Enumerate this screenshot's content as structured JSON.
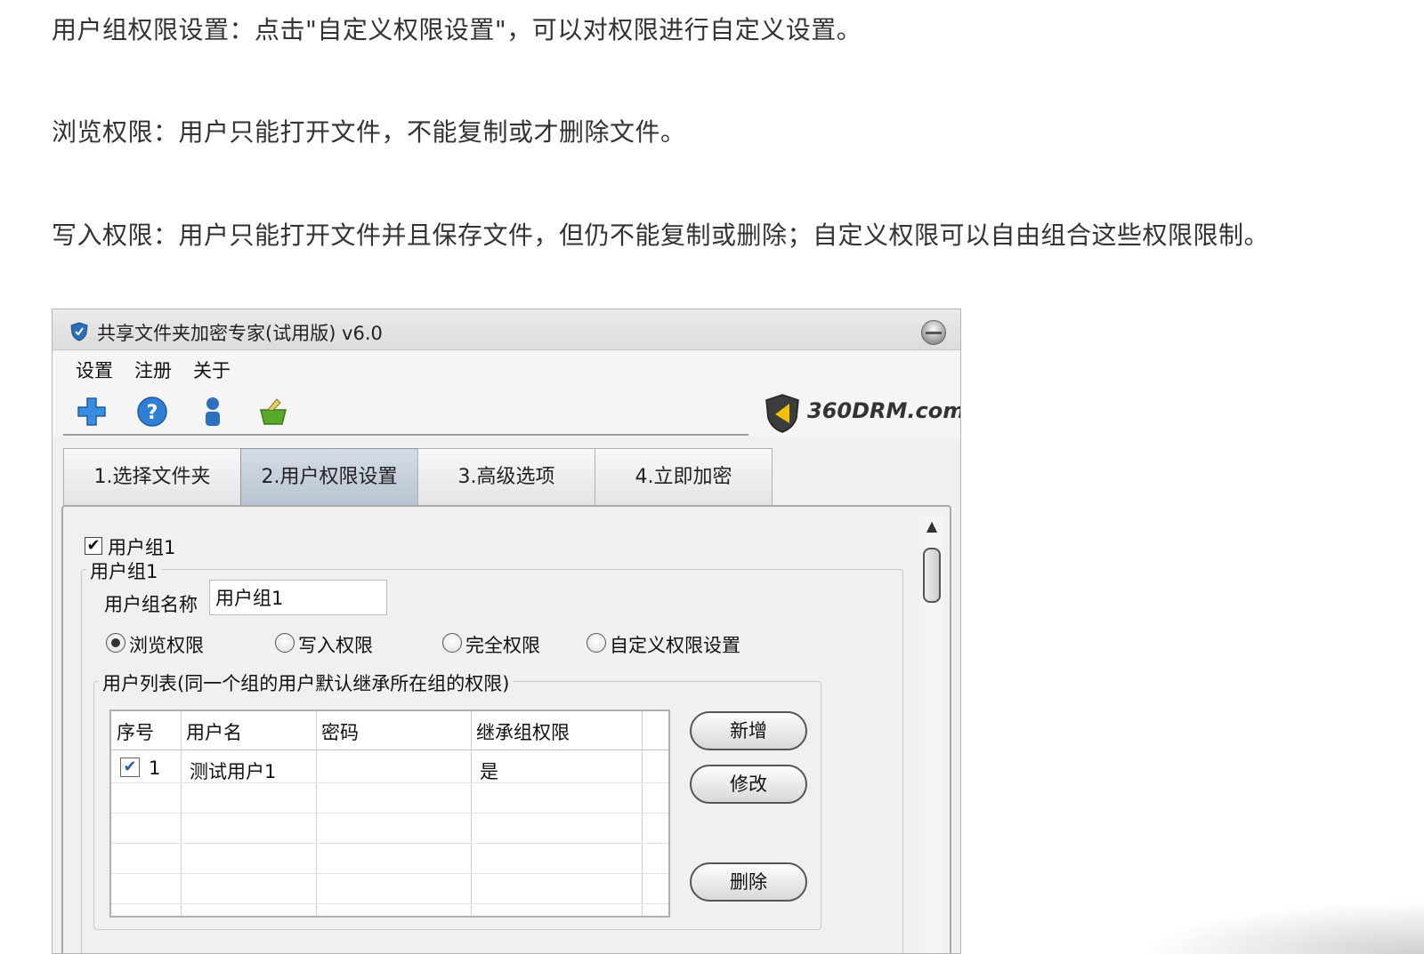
{
  "article": {
    "p1": "用户组权限设置：点击\"自定义权限设置\"，可以对权限进行自定义设置。",
    "p2": "浏览权限：用户只能打开文件，不能复制或才删除文件。",
    "p3": "写入权限：用户只能打开文件并且保存文件，但仍不能复制或删除；自定义权限可以自由组合这些权限限制。"
  },
  "window": {
    "title": "共享文件夹加密专家(试用版) v6.0",
    "menu": [
      "设置",
      "注册",
      "关于"
    ],
    "toolbar_icons": [
      "plus-icon",
      "help-icon",
      "user-icon",
      "basket-icon"
    ],
    "logo_text": "360DRM.com",
    "tabs": [
      "1.选择文件夹",
      "2.用户权限设置",
      "3.高级选项",
      "4.立即加密"
    ],
    "active_tab": 1
  },
  "group": {
    "checkbox_label": "用户组1",
    "checked": true,
    "box_title": "用户组1",
    "name_label": "用户组名称",
    "name_value": "用户组1",
    "permissions": [
      "浏览权限",
      "写入权限",
      "完全权限",
      "自定义权限设置"
    ],
    "selected_permission": 0
  },
  "user_list": {
    "title": "用户列表(同一个组的用户默认继承所在组的权限)",
    "columns": [
      "序号",
      "用户名",
      "密码",
      "继承组权限"
    ],
    "rows": [
      {
        "checked": true,
        "index": "1",
        "username": "测试用户1",
        "password": "",
        "inherit": "是"
      }
    ],
    "buttons": {
      "add": "新增",
      "edit": "修改",
      "delete": "删除"
    }
  },
  "colors": {
    "active_tab": "#b8c4d2",
    "icon_blue": "#2a7ad8",
    "icon_green": "#5aa82a"
  }
}
